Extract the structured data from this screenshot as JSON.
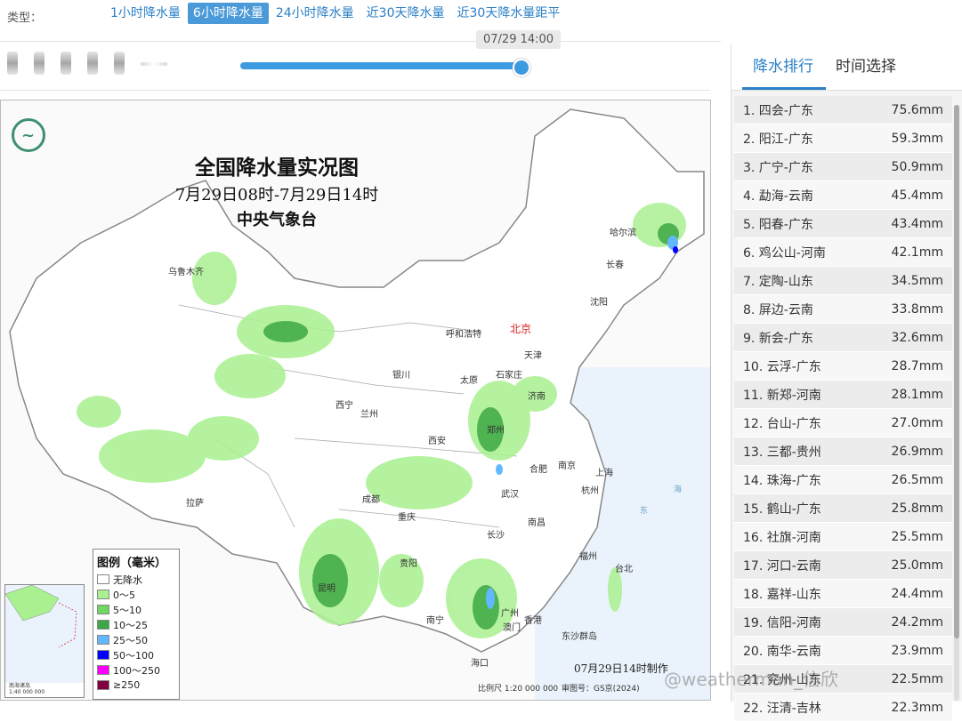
{
  "type_bar": {
    "label": "类型：",
    "tabs": [
      {
        "label": "1小时降水量",
        "active": false
      },
      {
        "label": "6小时降水量",
        "active": true
      },
      {
        "label": "24小时降水量",
        "active": false
      },
      {
        "label": "近30天降水量",
        "active": false
      },
      {
        "label": "近30天降水量距平",
        "active": false
      }
    ]
  },
  "timeline": {
    "current_time": "07/29 14:00",
    "progress": 1.0
  },
  "map": {
    "title": "全国降水量实况图",
    "period": "7月29日08时-7月29日14时",
    "issuer": "中央气象台",
    "made_time": "07月29日14时制作",
    "scale": "比例尺 1:20 000 000",
    "review": "审图号：GS京(2024)",
    "inset_label_1": "南海诸岛",
    "inset_label_2": "1:40 000 000",
    "cities": [
      {
        "name": "哈尔滨",
        "cap": false
      },
      {
        "name": "长春",
        "cap": false
      },
      {
        "name": "沈阳",
        "cap": false
      },
      {
        "name": "乌鲁木齐",
        "cap": false
      },
      {
        "name": "呼和浩特",
        "cap": false
      },
      {
        "name": "北京",
        "cap": true
      },
      {
        "name": "天津",
        "cap": false
      },
      {
        "name": "石家庄",
        "cap": false
      },
      {
        "name": "太原",
        "cap": false
      },
      {
        "name": "银川",
        "cap": false
      },
      {
        "name": "济南",
        "cap": false
      },
      {
        "name": "西宁",
        "cap": false
      },
      {
        "name": "兰州",
        "cap": false
      },
      {
        "name": "郑州",
        "cap": false
      },
      {
        "name": "西安",
        "cap": false
      },
      {
        "name": "合肥",
        "cap": false
      },
      {
        "name": "南京",
        "cap": false
      },
      {
        "name": "上海",
        "cap": false
      },
      {
        "name": "拉萨",
        "cap": false
      },
      {
        "name": "成都",
        "cap": false
      },
      {
        "name": "武汉",
        "cap": false
      },
      {
        "name": "杭州",
        "cap": false
      },
      {
        "name": "重庆",
        "cap": false
      },
      {
        "name": "长沙",
        "cap": false
      },
      {
        "name": "南昌",
        "cap": false
      },
      {
        "name": "贵阳",
        "cap": false
      },
      {
        "name": "福州",
        "cap": false
      },
      {
        "name": "台北",
        "cap": false
      },
      {
        "name": "昆明",
        "cap": false
      },
      {
        "name": "广州",
        "cap": false
      },
      {
        "name": "南宁",
        "cap": false
      },
      {
        "name": "澳门",
        "cap": false
      },
      {
        "name": "香港",
        "cap": false
      },
      {
        "name": "海口",
        "cap": false
      },
      {
        "name": "东沙群岛",
        "cap": false
      }
    ],
    "seas": [
      "东",
      "海"
    ],
    "legend": {
      "title": "图例（毫米）",
      "items": [
        {
          "label": "无降水",
          "color": "#ffffff"
        },
        {
          "label": "0～5",
          "color": "#a9f090"
        },
        {
          "label": "5～10",
          "color": "#72d665"
        },
        {
          "label": "10～25",
          "color": "#3da843"
        },
        {
          "label": "25～50",
          "color": "#62b8ff"
        },
        {
          "label": "50～100",
          "color": "#0000fe"
        },
        {
          "label": "100～250",
          "color": "#fa00fa"
        },
        {
          "label": "≥250",
          "color": "#800040"
        }
      ]
    }
  },
  "watermark": "@weatherman_信欣",
  "panel": {
    "tabs": [
      {
        "label": "降水排行",
        "active": true
      },
      {
        "label": "时间选择",
        "active": false
      }
    ],
    "ranking": [
      {
        "name": "1. 四会-广东",
        "value": "75.6mm"
      },
      {
        "name": "2. 阳江-广东",
        "value": "59.3mm"
      },
      {
        "name": "3. 广宁-广东",
        "value": "50.9mm"
      },
      {
        "name": "4. 勐海-云南",
        "value": "45.4mm"
      },
      {
        "name": "5. 阳春-广东",
        "value": "43.4mm"
      },
      {
        "name": "6. 鸡公山-河南",
        "value": "42.1mm"
      },
      {
        "name": "7. 定陶-山东",
        "value": "34.5mm"
      },
      {
        "name": "8. 屏边-云南",
        "value": "33.8mm"
      },
      {
        "name": "9. 新会-广东",
        "value": "32.6mm"
      },
      {
        "name": "10. 云浮-广东",
        "value": "28.7mm"
      },
      {
        "name": "11. 新郑-河南",
        "value": "28.1mm"
      },
      {
        "name": "12. 台山-广东",
        "value": "27.0mm"
      },
      {
        "name": "13. 三都-贵州",
        "value": "26.9mm"
      },
      {
        "name": "14. 珠海-广东",
        "value": "26.5mm"
      },
      {
        "name": "15. 鹤山-广东",
        "value": "25.8mm"
      },
      {
        "name": "16. 社旗-河南",
        "value": "25.5mm"
      },
      {
        "name": "17. 河口-云南",
        "value": "25.0mm"
      },
      {
        "name": "18. 嘉祥-山东",
        "value": "24.4mm"
      },
      {
        "name": "19. 信阳-河南",
        "value": "24.2mm"
      },
      {
        "name": "20. 南华-云南",
        "value": "23.9mm"
      },
      {
        "name": "21. 兖州-山东",
        "value": "22.5mm"
      },
      {
        "name": "22. 汪清-吉林",
        "value": "22.3mm"
      }
    ]
  }
}
